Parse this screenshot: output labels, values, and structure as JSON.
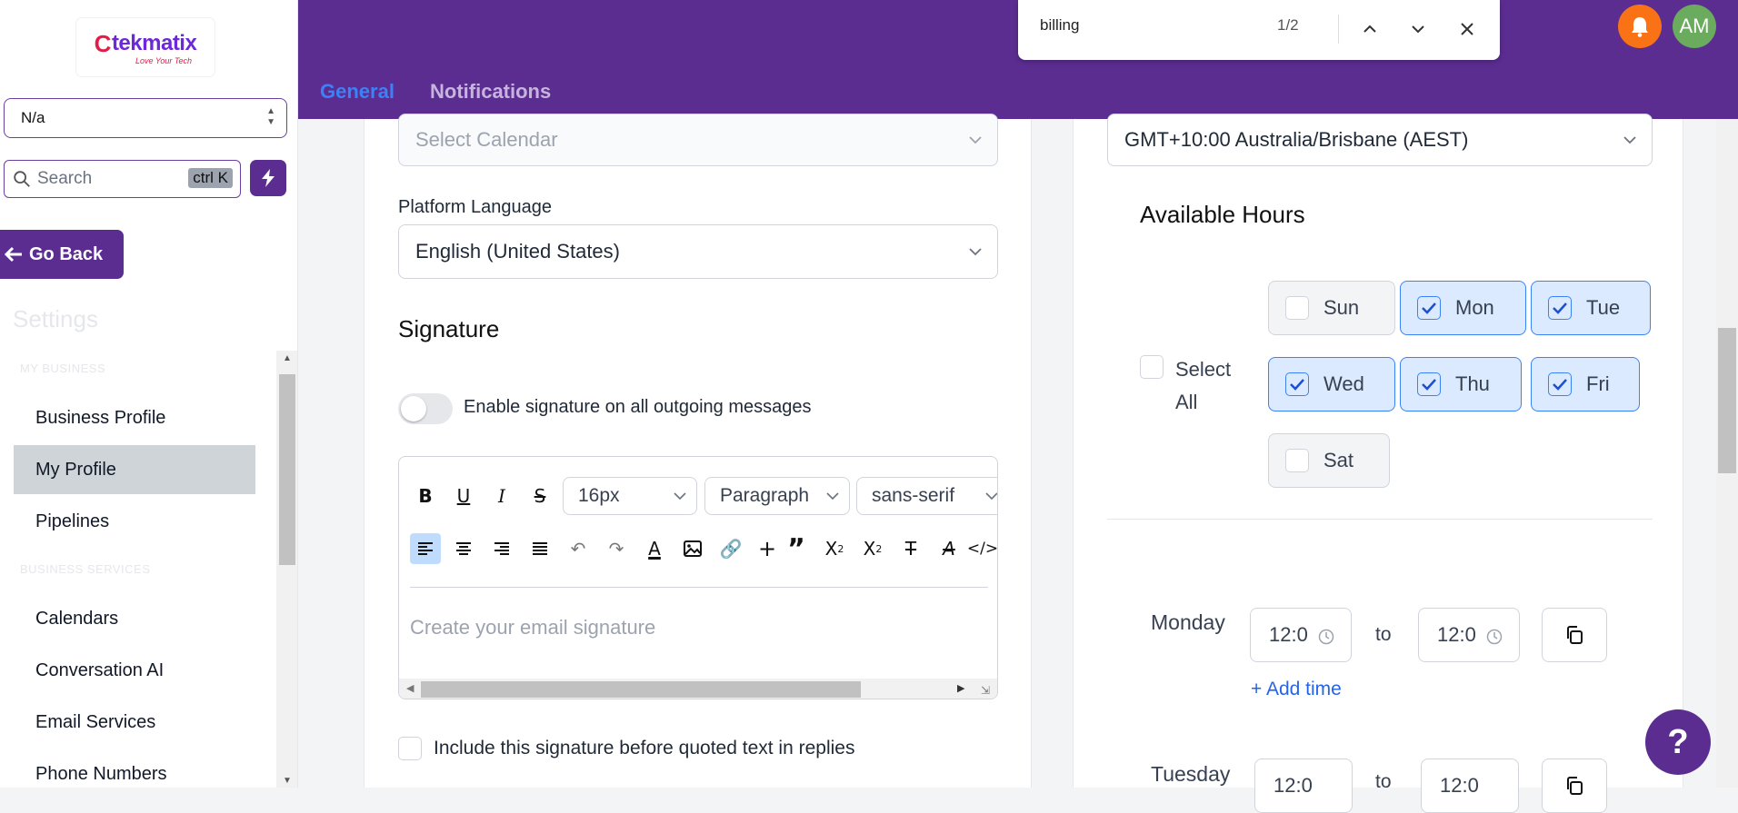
{
  "brand": {
    "name": "tekmatix",
    "tagline": "Love Your Tech",
    "accent": "#5b2d91"
  },
  "sidebar": {
    "location_select": "N/a",
    "search_placeholder": "Search",
    "search_shortcut": "ctrl K",
    "go_back": "Go Back",
    "settings_title": "Settings",
    "section_business": "MY BUSINESS",
    "section_services": "BUSINESS SERVICES",
    "items": [
      {
        "label": "Business Profile"
      },
      {
        "label": "My Profile",
        "active": true
      },
      {
        "label": "Pipelines"
      },
      {
        "label": "Calendars"
      },
      {
        "label": "Conversation AI"
      },
      {
        "label": "Email Services"
      },
      {
        "label": "Phone Numbers"
      }
    ]
  },
  "header": {
    "tabs": [
      {
        "label": "General",
        "active": true
      },
      {
        "label": "Notifications"
      }
    ],
    "find": {
      "query": "billing",
      "count": "1/2"
    },
    "avatar_initials": "AM"
  },
  "left": {
    "calendar_placeholder": "Select Calendar",
    "language_label": "Platform Language",
    "language_value": "English (United States)",
    "signature_title": "Signature",
    "toggle_label": "Enable signature on all outgoing messages",
    "toggle_on": false,
    "editor": {
      "font_size": "16px",
      "block_type": "Paragraph",
      "font_family": "sans-serif",
      "placeholder": "Create your email signature"
    },
    "include_label": "Include this signature before quoted text in replies"
  },
  "right": {
    "timezone": "GMT+10:00 Australia/Brisbane (AEST)",
    "available_title": "Available Hours",
    "select_all_label": "Select All",
    "days": [
      {
        "label": "Sun",
        "checked": false
      },
      {
        "label": "Mon",
        "checked": true
      },
      {
        "label": "Tue",
        "checked": true
      },
      {
        "label": "Wed",
        "checked": true
      },
      {
        "label": "Thu",
        "checked": true
      },
      {
        "label": "Fri",
        "checked": true
      },
      {
        "label": "Sat",
        "checked": false
      }
    ],
    "schedule": [
      {
        "day": "Monday",
        "from": "12:0",
        "to_word": "to",
        "to": "12:0",
        "add_time": "+ Add time"
      },
      {
        "day": "Tuesday",
        "from": "12:0",
        "to_word": "to",
        "to": "12:0"
      }
    ]
  },
  "help_label": "?"
}
